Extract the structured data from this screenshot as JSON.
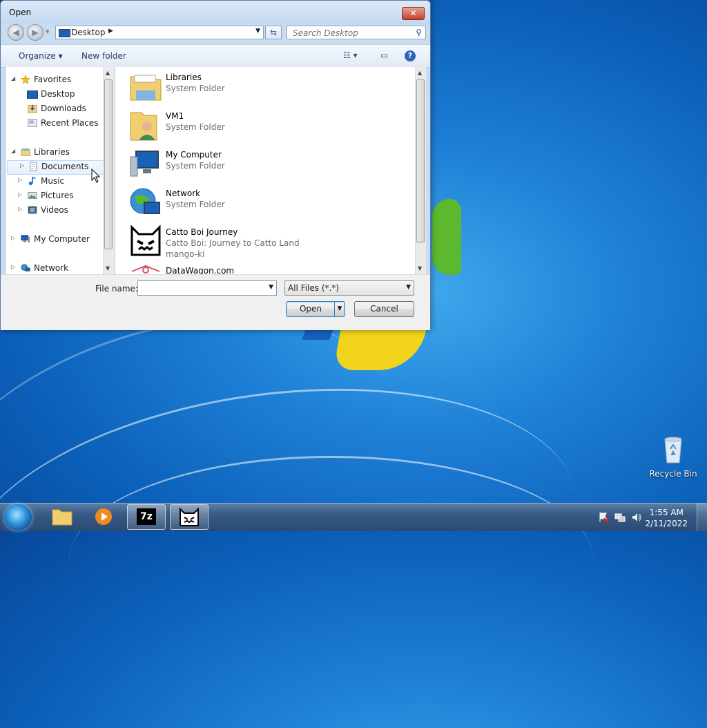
{
  "dialog": {
    "title": "Open",
    "close_label": "✕"
  },
  "address_bar": {
    "path": "Desktop"
  },
  "search": {
    "placeholder": "Search Desktop"
  },
  "toolbar": {
    "organize_label": "Organize ▾",
    "new_folder_label": "New folder"
  },
  "nav": {
    "favorites": {
      "label": "Favorites",
      "items": [
        {
          "label": "Desktop",
          "icon": "desktop-icon"
        },
        {
          "label": "Downloads",
          "icon": "downloads-icon"
        },
        {
          "label": "Recent Places",
          "icon": "recent-places-icon"
        }
      ]
    },
    "libraries": {
      "label": "Libraries",
      "items": [
        {
          "label": "Documents",
          "icon": "documents-icon"
        },
        {
          "label": "Music",
          "icon": "music-icon"
        },
        {
          "label": "Pictures",
          "icon": "pictures-icon"
        },
        {
          "label": "Videos",
          "icon": "videos-icon"
        }
      ]
    },
    "computer": {
      "label": "My Computer"
    },
    "network": {
      "label": "Network"
    }
  },
  "files": [
    {
      "name": "Libraries",
      "sub": "System Folder",
      "icon": "libraries-folder-icon"
    },
    {
      "name": "VM1",
      "sub": "System Folder",
      "icon": "user-folder-icon"
    },
    {
      "name": "My Computer",
      "sub": "System Folder",
      "icon": "computer-icon"
    },
    {
      "name": "Network",
      "sub": "System Folder",
      "icon": "network-icon"
    },
    {
      "name": "Catto Boi Journey",
      "sub": "Catto Boi: Journey to Catto Land",
      "sub2": "mango-ki",
      "icon": "catto-boi-icon"
    },
    {
      "name": "DataWagon.com",
      "sub": "",
      "icon": "datawagon-icon"
    }
  ],
  "bottom": {
    "file_name_label": "File name:",
    "file_name_value": "",
    "file_type": "All Files (*.*)",
    "open_label": "Open",
    "cancel_label": "Cancel"
  },
  "desktop": {
    "recycle_bin_label": "Recycle Bin"
  },
  "taskbar": {
    "time": "1:55 AM",
    "date": "2/11/2022",
    "app_7zip_label": "7z"
  },
  "colors": {
    "accent": "#1e7fd6",
    "dialog_frame": "#c9dcf0",
    "taskbar": "#365a85"
  }
}
